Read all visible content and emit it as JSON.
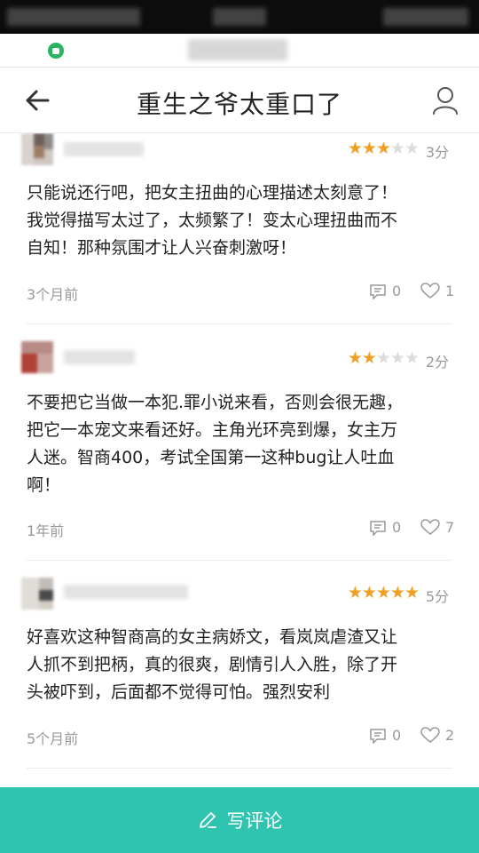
{
  "header": {
    "title": "重生之爷太重口了"
  },
  "colors": {
    "accent": "#2ec4b0",
    "star_on": "#f0a020",
    "star_off": "#dcdcdc"
  },
  "reviews": [
    {
      "rating": 3,
      "score": "3分",
      "text_lines": [
        "只能说还行吧，把女主扭曲的心理描述太刻意了！",
        "我觉得描写太过了，太频繁了！变太心理扭曲而不",
        "自知！那种氛围才让人兴奋刺激呀！"
      ],
      "time": "3个月前",
      "comments": "0",
      "likes": "1"
    },
    {
      "rating": 2,
      "score": "2分",
      "text_lines": [
        "不要把它当做一本犯.罪小说来看，否则会很无趣，",
        "把它一本宠文来看还好。主角光环亮到爆，女主万",
        "人迷。智商400，考试全国第一这种bug让人吐血",
        "啊！"
      ],
      "time": "1年前",
      "comments": "0",
      "likes": "7"
    },
    {
      "rating": 5,
      "score": "5分",
      "text_lines": [
        "好喜欢这种智商高的女主病娇文，看岚岚虐渣又让",
        "人抓不到把柄，真的很爽，剧情引人入胜，除了开",
        "头被吓到，后面都不觉得可怕。强烈安利"
      ],
      "time": "5个月前",
      "comments": "0",
      "likes": "2"
    }
  ],
  "footer": {
    "write_label": "写评论"
  },
  "icons": [
    "back-arrow-icon",
    "user-icon",
    "comment-icon",
    "heart-icon",
    "edit-icon",
    "lock-icon"
  ]
}
